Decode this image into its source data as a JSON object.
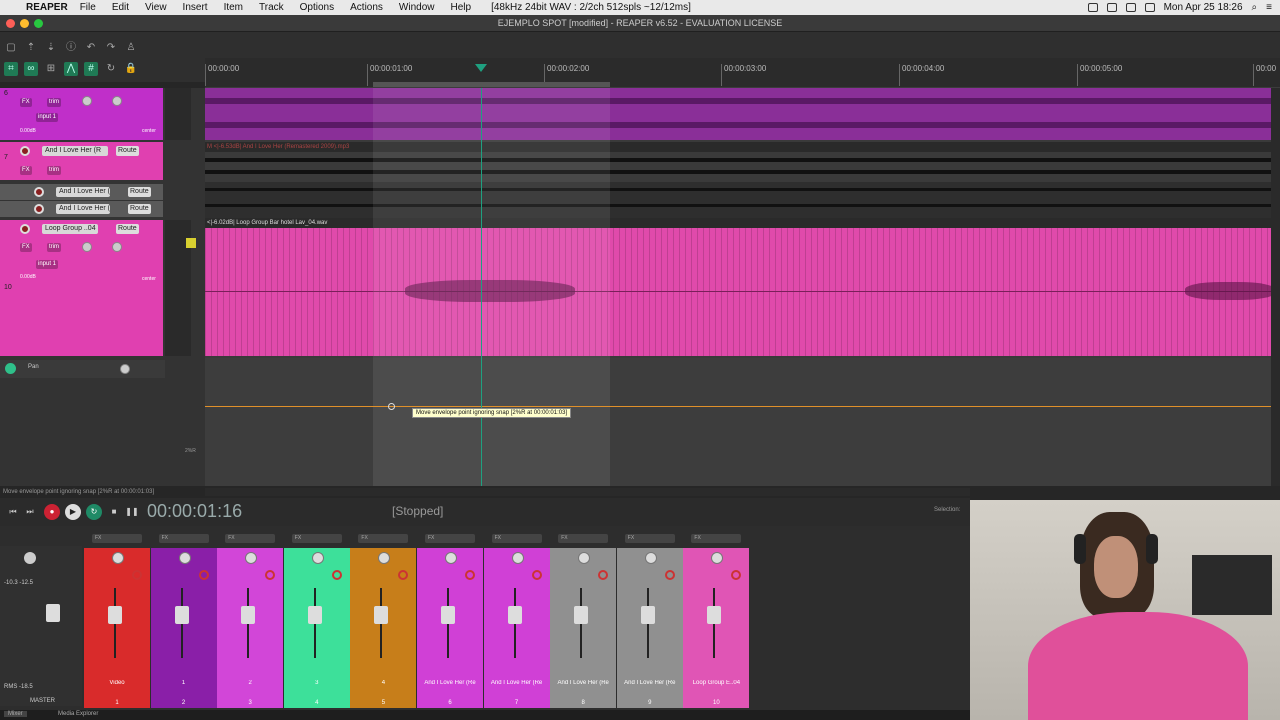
{
  "menubar": {
    "app": "REAPER",
    "items": [
      "File",
      "Edit",
      "View",
      "Insert",
      "Item",
      "Track",
      "Options",
      "Actions",
      "Window",
      "Help"
    ],
    "status": "[48kHz 24bit WAV : 2/2ch 512spls ~12/12ms]",
    "clock": "Mon Apr 25  18:26"
  },
  "window": {
    "title": "EJEMPLO SPOT [modified] - REAPER v6.52 - EVALUATION LICENSE"
  },
  "ruler": {
    "ticks": [
      "00:00:00",
      "00:00:01:00",
      "00:00:02:00",
      "00:00:03:00",
      "00:00:04:00",
      "00:00:05:00",
      "00:00"
    ]
  },
  "tracks": {
    "t6": {
      "num": "6",
      "fx": "FX",
      "trim": "trim",
      "input": "input 1",
      "vol": "0.00dB",
      "pan": "center"
    },
    "t7": {
      "num": "7",
      "name": "And I Love Her (R",
      "route": "Route",
      "fx": "FX",
      "trim": "trim"
    },
    "t8": {
      "num": "8",
      "name": "And I Love Her (R",
      "route": "Route"
    },
    "t9": {
      "num": "9",
      "name": "And I Love Her (R",
      "route": "Route"
    },
    "t10": {
      "num": "10",
      "name": "Loop Group ..04",
      "route": "Route",
      "fx": "FX",
      "trim": "trim",
      "input": "input 1",
      "vol": "0.00dB",
      "pan": "center"
    },
    "env": {
      "label": "Pan",
      "value": "2%R"
    }
  },
  "items": {
    "item7": "M  <|-6.53dB| And I Love Her (Remastered 2009).mp3",
    "item10": "<|-6.02dB| Loop Group Bar hotel Lav_04.wav"
  },
  "tooltip": "Move envelope point ignoring snap [2%R at 00:00:01:03]",
  "statusline": "Move envelope point ignoring snap [2%R at 00:00:01:03]",
  "transport": {
    "time": "00:00:01:16",
    "state": "[Stopped]",
    "selection": "Selection:"
  },
  "mixer": {
    "master": {
      "label": "MASTER",
      "peak": "-10.3  -12.5",
      "rms": "RMS  -18.5"
    },
    "strips": [
      {
        "name": "Video",
        "num": "1",
        "color": "#d92b2b"
      },
      {
        "name": "1",
        "num": "2",
        "color": "#8a1fa8"
      },
      {
        "name": "2",
        "num": "3",
        "color": "#d246d8"
      },
      {
        "name": "3",
        "num": "4",
        "color": "#3de09a"
      },
      {
        "name": "4",
        "num": "5",
        "color": "#c77e1a"
      },
      {
        "name": "And I Love Her (Re",
        "num": "6",
        "color": "#d040d6"
      },
      {
        "name": "And I Love Her (Re",
        "num": "7",
        "color": "#d040d6"
      },
      {
        "name": "And I Love Her (Re",
        "num": "8",
        "color": "#909090"
      },
      {
        "name": "And I Love Her (Re",
        "num": "9",
        "color": "#909090"
      },
      {
        "name": "Loop Group E..04",
        "num": "10",
        "color": "#e055b5"
      }
    ]
  },
  "bottomtabs": {
    "mixer": "Mixer",
    "explorer": "Media Explorer"
  },
  "colors": {
    "track_pink": "#e040b0",
    "track_purple": "#b42fc0",
    "envelope": "#e0902a",
    "cursor": "#1fa080"
  }
}
